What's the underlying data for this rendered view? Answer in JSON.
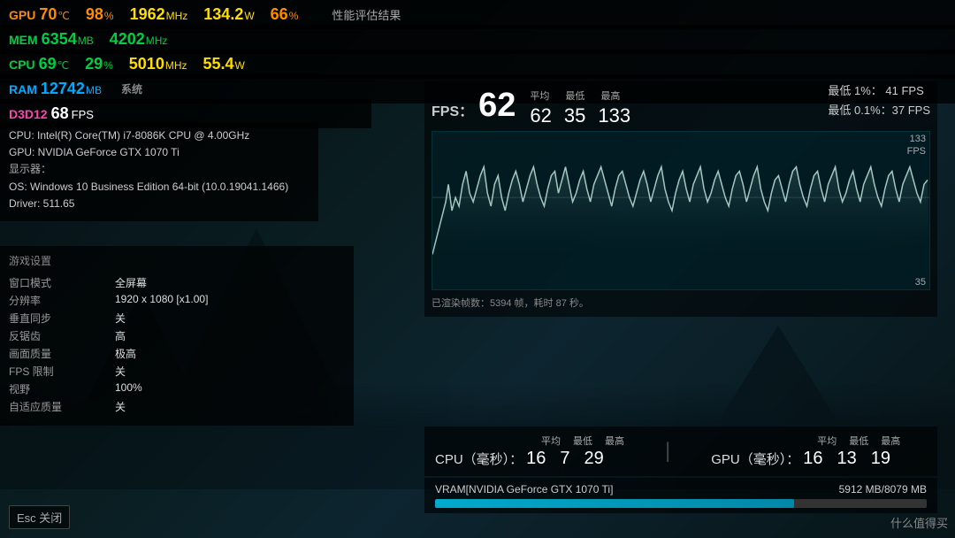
{
  "background": {
    "color": "#0a1a1f"
  },
  "hud": {
    "top_stats": {
      "row1": [
        {
          "label": "GPU",
          "value": "70",
          "unit": "℃",
          "label_color": "orange"
        },
        {
          "value": "98",
          "unit": "%",
          "value_color": "orange"
        },
        {
          "value": "1962",
          "unit": "MHz",
          "value_color": "yellow"
        },
        {
          "value": "134.2",
          "unit": "W",
          "value_color": "yellow"
        },
        {
          "value": "66",
          "unit": "%",
          "value_color": "orange"
        },
        {
          "label": "性能评估结果",
          "label_color": "gray"
        }
      ],
      "row2": [
        {
          "label": "MEM",
          "value": "6354",
          "unit": "MB",
          "label_color": "green"
        },
        {
          "value": "4202",
          "unit": "MHz",
          "value_color": "green"
        }
      ],
      "row3": [
        {
          "label": "CPU",
          "value": "69",
          "unit": "℃",
          "label_color": "green"
        },
        {
          "value": "29",
          "unit": "%",
          "value_color": "green"
        },
        {
          "value": "5010",
          "unit": "MHz",
          "value_color": "yellow"
        },
        {
          "value": "55.4",
          "unit": "W",
          "value_color": "yellow"
        }
      ],
      "row4": [
        {
          "label": "RAM",
          "value": "12742",
          "unit": "MB",
          "label_color": "blue"
        },
        {
          "label": "系统",
          "label_color": "gray"
        }
      ],
      "row5": [
        {
          "label": "D3D12",
          "value": "68",
          "unit": "FPS",
          "label_color": "pink"
        }
      ]
    },
    "sys_info": {
      "cpu_line": "CPU: Intel(R) Core(TM) i7-8086K CPU @ 4.00GHz",
      "gpu_line": "GPU: NVIDIA GeForce GTX 1070 Ti",
      "display_header": "显示器：",
      "os_line": "OS: Windows 10 Business Edition 64-bit (10.0.19041.1466)",
      "driver_line": "Driver: 511.65"
    },
    "game_settings": {
      "title": "游戏设置",
      "rows": [
        {
          "key": "窗口模式",
          "value": "全屏幕"
        },
        {
          "key": "分辨率",
          "value": "1920 x 1080 [x1.00]"
        },
        {
          "key": "垂直同步",
          "value": "关"
        },
        {
          "key": "反锯齿",
          "value": "高"
        },
        {
          "key": "画面质量",
          "value": "极高"
        },
        {
          "key": "FPS 限制",
          "value": "关"
        },
        {
          "key": "视野",
          "value": "100%"
        },
        {
          "key": "自适应质量",
          "value": "关"
        }
      ]
    },
    "fps_panel": {
      "label": "FPS：",
      "main_value": "62",
      "stats_headers": [
        "平均",
        "最低",
        "最高"
      ],
      "stats_values": [
        "62",
        "35",
        "133"
      ],
      "right_stats": [
        "最低 1%：  41 FPS",
        "最低 0.1%：37 FPS"
      ],
      "chart_max": "133",
      "chart_mid": "",
      "chart_min": "35",
      "rendered_info": "已渲染帧数：5394 帧，耗时 87 秒。",
      "fps_label_right": "FPS"
    },
    "timing_panel": {
      "cpu_label": "CPU（毫秒）：",
      "cpu_stats_headers": [
        "平均",
        "最低",
        "最高"
      ],
      "cpu_stats_values": [
        "16",
        "7",
        "29"
      ],
      "gpu_label": "GPU（毫秒）：",
      "gpu_stats_headers": [
        "平均",
        "最低",
        "最高"
      ],
      "gpu_stats_values": [
        "16",
        "13",
        "19"
      ]
    },
    "vram_panel": {
      "label": "VRAM[NVIDIA GeForce GTX 1070 Ti]",
      "value": "5912 MB/8079 MB",
      "fill_percent": 73
    },
    "esc_button": "Esc 关闭",
    "watermark": "什么值得买"
  }
}
